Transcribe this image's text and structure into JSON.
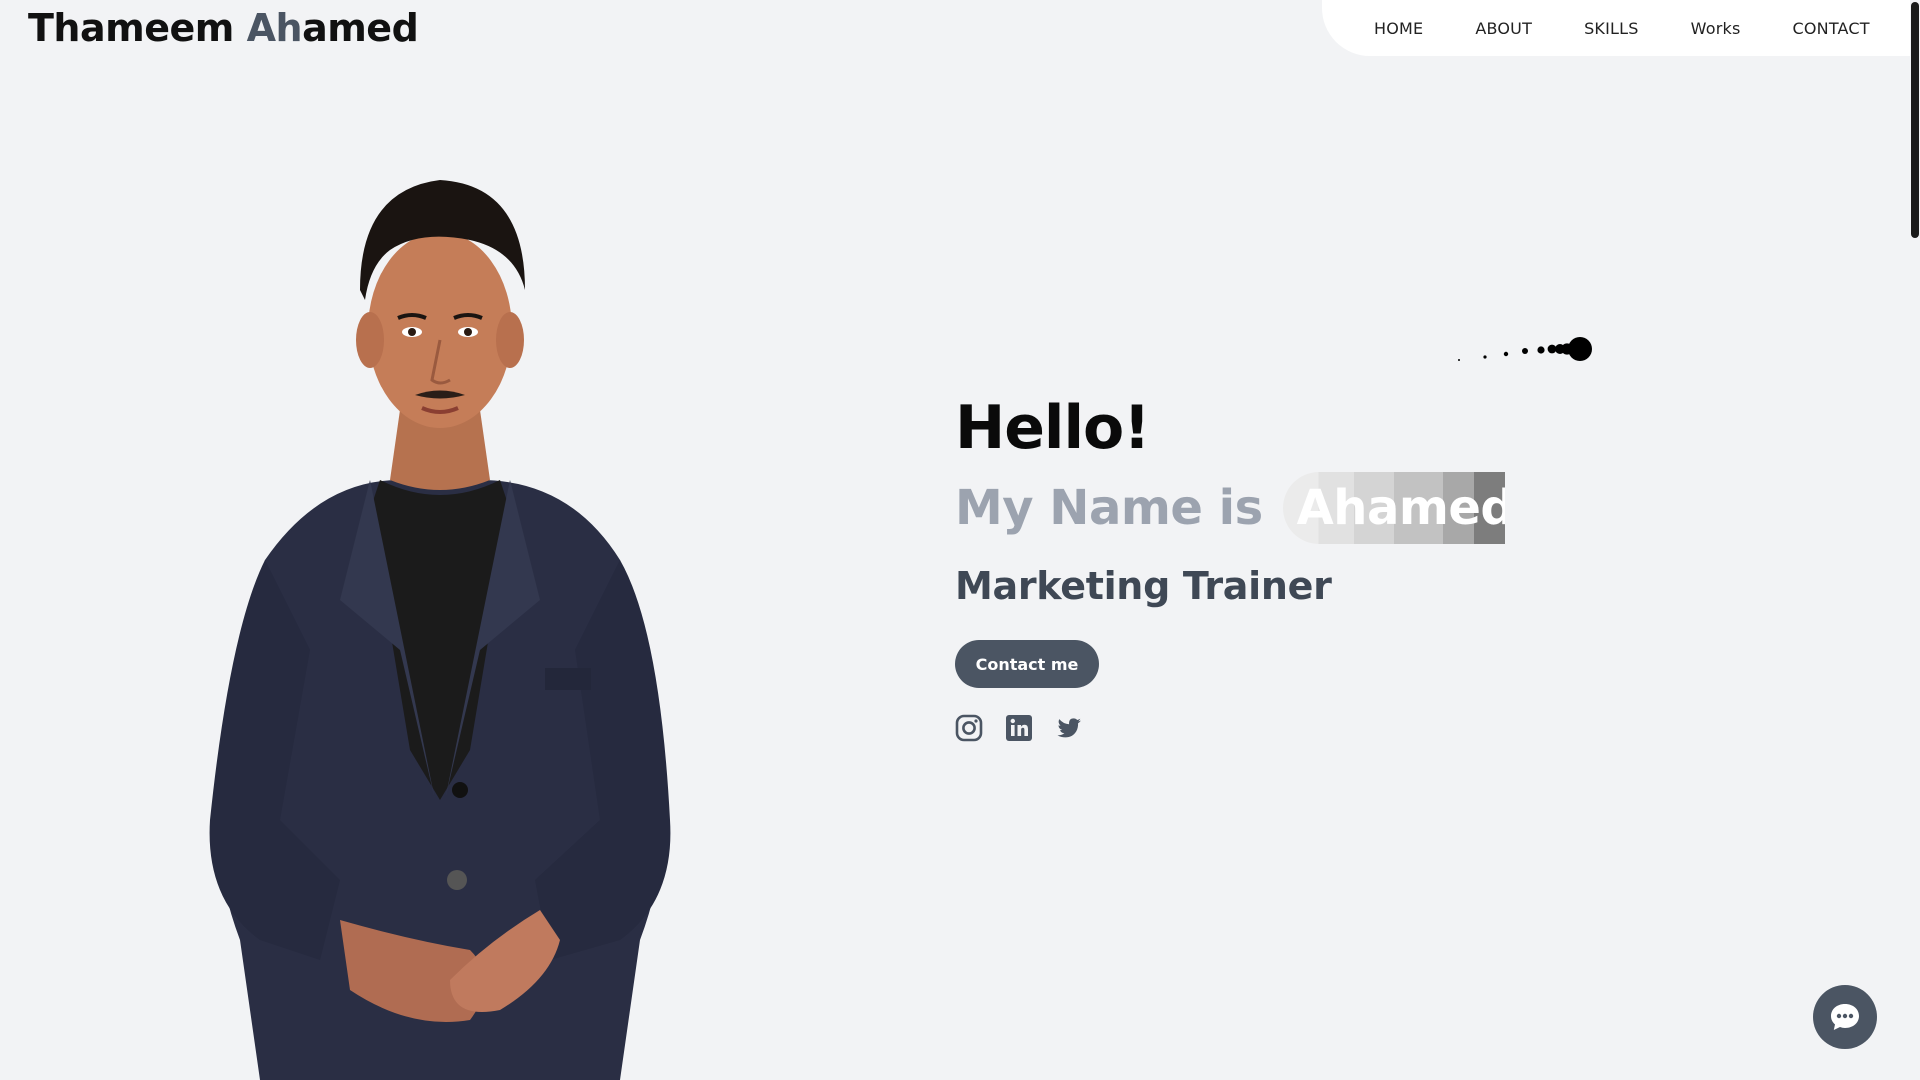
{
  "logo": {
    "first": "Thameem ",
    "accent": "Ah",
    "rest": "amed"
  },
  "nav": {
    "items": [
      "HOME",
      "ABOUT",
      "SKILLS",
      "Works",
      "CONTACT"
    ]
  },
  "hero": {
    "greeting": "Hello!",
    "name_prefix": "My Name is",
    "name_highlight": "Ahamed",
    "role": "Marketing Trainer",
    "cta_label": "Contact me"
  },
  "socials": [
    "instagram-icon",
    "linkedin-icon",
    "twitter-icon"
  ],
  "colors": {
    "background": "#f2f3f5",
    "primary_dark": "#4b5563",
    "muted_text": "#9ca3af",
    "heading": "#0a0a0a"
  }
}
